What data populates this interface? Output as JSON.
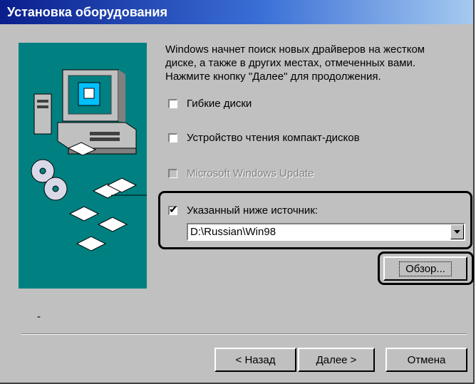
{
  "window": {
    "title": "Установка оборудования"
  },
  "intro": {
    "line1": "Windows начнет поиск новых драйверов на жестком",
    "line2": "диске, а также в других местах, отмеченных вами.",
    "line3": "Нажмите кнопку \"Далее\" для продолжения."
  },
  "options": {
    "floppy": {
      "label": "Гибкие диски",
      "checked": false,
      "enabled": true
    },
    "cdrom": {
      "label": "Устройство чтения компакт-дисков",
      "checked": false,
      "enabled": true
    },
    "windows_update": {
      "label": "Microsoft Windows Update",
      "checked": false,
      "enabled": false
    },
    "specified": {
      "label": "Указанный ниже источник:",
      "checked": true,
      "enabled": true
    }
  },
  "source_path": {
    "value": "D:\\Russian\\Win98"
  },
  "buttons": {
    "browse": "Обзор...",
    "back": "< Назад",
    "next": "Далее >",
    "cancel": "Отмена"
  },
  "status": {
    "dot": "-"
  },
  "colors": {
    "dialog_bg": "#c0c0c0",
    "art_bg": "#008080",
    "title_start": "#0a1e8c",
    "title_end": "#a6caf0"
  }
}
